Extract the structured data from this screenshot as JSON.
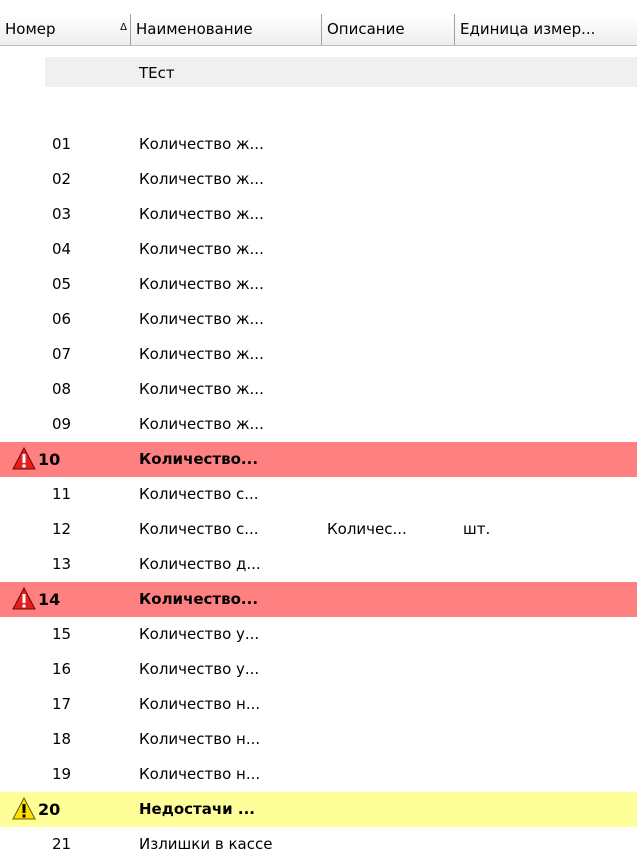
{
  "columns": [
    {
      "label": "Номер"
    },
    {
      "label": "Наименование"
    },
    {
      "label": "Описание"
    },
    {
      "label": "Единица измер..."
    }
  ],
  "colors": {
    "error_row": "#ff8080",
    "warning_row": "#ffff99",
    "group_row": "#f0f0f0"
  },
  "rows": [
    {
      "type": "group",
      "name": "ТЕст"
    },
    {
      "type": "blank"
    },
    {
      "type": "normal",
      "num": "01",
      "name": "Количество ж..."
    },
    {
      "type": "normal",
      "num": "02",
      "name": "Количество ж..."
    },
    {
      "type": "normal",
      "num": "03",
      "name": "Количество ж..."
    },
    {
      "type": "normal",
      "num": "04",
      "name": "Количество ж..."
    },
    {
      "type": "normal",
      "num": "05",
      "name": "Количество ж..."
    },
    {
      "type": "normal",
      "num": "06",
      "name": "Количество ж..."
    },
    {
      "type": "normal",
      "num": "07",
      "name": "Количество ж..."
    },
    {
      "type": "normal",
      "num": "08",
      "name": "Количество ж..."
    },
    {
      "type": "normal",
      "num": "09",
      "name": "Количество ж..."
    },
    {
      "type": "error",
      "icon": "error-warning-icon",
      "num": "10",
      "name": "Количество..."
    },
    {
      "type": "normal",
      "num": "11",
      "name": "Количество с..."
    },
    {
      "type": "normal",
      "num": "12",
      "name": "Количество с...",
      "desc": "Количес...",
      "unit": "шт."
    },
    {
      "type": "normal",
      "num": "13",
      "name": "Количество д..."
    },
    {
      "type": "error",
      "icon": "error-warning-icon",
      "num": "14",
      "name": "Количество..."
    },
    {
      "type": "normal",
      "num": "15",
      "name": "Количество у..."
    },
    {
      "type": "normal",
      "num": "16",
      "name": "Количество у..."
    },
    {
      "type": "normal",
      "num": "17",
      "name": "Количество н..."
    },
    {
      "type": "normal",
      "num": "18",
      "name": "Количество н..."
    },
    {
      "type": "normal",
      "num": "19",
      "name": "Количество н..."
    },
    {
      "type": "warn",
      "icon": "caution-warning-icon",
      "num": "20",
      "name": "Недостачи ..."
    },
    {
      "type": "normal",
      "num": "21",
      "name": "Излишки в кассе"
    }
  ]
}
